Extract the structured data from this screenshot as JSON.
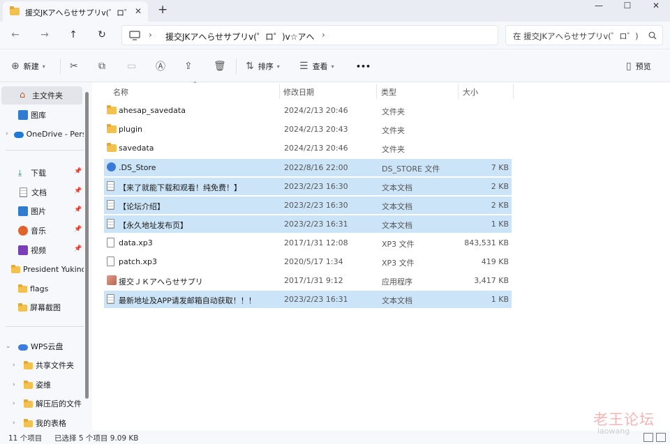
{
  "window": {
    "tab_title": "援交JKアへらせサプリv(゜ロ゜)v☆アへ",
    "new_tab": "+",
    "close_tab": "✕",
    "minimize": "—",
    "maximize": "☐",
    "close": "✕"
  },
  "address": {
    "path": "援交JKアへらせサプリv(゜ロ゜)v☆アへ",
    "search_placeholder": "在 援交JKアへらせサプリv(゜ロ゜)v☆アへ 中搜索"
  },
  "toolbar": {
    "new_label": "新建",
    "sort_label": "排序",
    "view_label": "查看",
    "more_label": "•••",
    "preview_label": "预览"
  },
  "sidebar": {
    "items": [
      {
        "label": "主文件夹"
      },
      {
        "label": "图库"
      },
      {
        "label": "OneDrive - Personal"
      },
      {
        "label": "下载"
      },
      {
        "label": "文档"
      },
      {
        "label": "图片"
      },
      {
        "label": "音乐"
      },
      {
        "label": "视频"
      },
      {
        "label": "President Yukino"
      },
      {
        "label": "flags"
      },
      {
        "label": "屏幕截图"
      },
      {
        "label": "WPS云盘"
      },
      {
        "label": "共享文件夹"
      },
      {
        "label": "姿维"
      },
      {
        "label": "解压后的文件"
      },
      {
        "label": "我的表格"
      }
    ]
  },
  "columns": {
    "name": "名称",
    "modified": "修改日期",
    "type": "类型",
    "size": "大小"
  },
  "files": [
    {
      "name": "ahesap_savedata",
      "date": "2024/2/13 20:46",
      "type": "文件夹",
      "size": "",
      "icon": "folder-icon",
      "selected": false
    },
    {
      "name": "plugin",
      "date": "2024/2/13 20:43",
      "type": "文件夹",
      "size": "",
      "icon": "folder-icon",
      "selected": false
    },
    {
      "name": "savedata",
      "date": "2024/2/13 20:46",
      "type": "文件夹",
      "size": "",
      "icon": "folder-icon",
      "selected": false
    },
    {
      "name": ".DS_Store",
      "date": "2022/8/16 22:00",
      "type": "DS_STORE 文件",
      "size": "7 KB",
      "icon": "ds-store-icon",
      "selected": true
    },
    {
      "name": "【来了就能下载和观看！纯免费！】",
      "date": "2023/2/23 16:30",
      "type": "文本文档",
      "size": "2 KB",
      "icon": "text-doc-icon",
      "selected": true
    },
    {
      "name": "【论坛介绍】",
      "date": "2023/2/23 16:30",
      "type": "文本文档",
      "size": "2 KB",
      "icon": "text-doc-icon",
      "selected": true
    },
    {
      "name": "【永久地址发布页】",
      "date": "2023/2/23 16:31",
      "type": "文本文档",
      "size": "1 KB",
      "icon": "text-doc-icon",
      "selected": true
    },
    {
      "name": "data.xp3",
      "date": "2017/1/31 12:08",
      "type": "XP3 文件",
      "size": "843,531 KB",
      "icon": "file-icon",
      "selected": false
    },
    {
      "name": "patch.xp3",
      "date": "2020/5/17 1:34",
      "type": "XP3 文件",
      "size": "419 KB",
      "icon": "file-icon",
      "selected": false
    },
    {
      "name": "援交ＪＫアへらせサプリ",
      "date": "2017/1/31 9:12",
      "type": "应用程序",
      "size": "3,417 KB",
      "icon": "app-icon",
      "selected": false
    },
    {
      "name": "最新地址及APP请发邮箱自动获取！！！",
      "date": "2023/2/23 16:31",
      "type": "文本文档",
      "size": "1 KB",
      "icon": "text-doc-icon",
      "selected": true
    }
  ],
  "status": {
    "count": "11 个项目",
    "selection": "已选择 5 个项目  9.09 KB"
  },
  "watermark": {
    "text": "老王论坛",
    "url": "laowang"
  },
  "colors": {
    "selection": "#cce4f7",
    "chrome": "#f6f8fb",
    "folder": "#f2c14e",
    "accent": "#0067c0"
  }
}
